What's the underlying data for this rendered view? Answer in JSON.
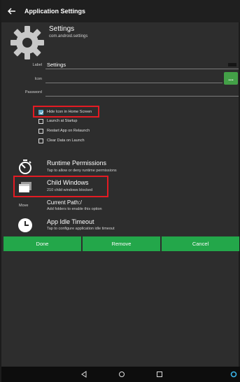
{
  "appbar": {
    "title": "Application Settings"
  },
  "app": {
    "name": "Settings",
    "package": "com.android.settings"
  },
  "form": {
    "label_caption": "Label",
    "label_value": "Settings",
    "icon_caption": "Icon",
    "icon_button": "...",
    "password_caption": "Password"
  },
  "options": [
    {
      "label": "Hide Icon in Home Screen",
      "checked": true
    },
    {
      "label": "Launch at Startup",
      "checked": false
    },
    {
      "label": "Restart App on Relaunch",
      "checked": false
    },
    {
      "label": "Clear Data on Launch",
      "checked": false
    }
  ],
  "sections": {
    "permissions": {
      "title": "Runtime Permissions",
      "subtitle": "Tap to allow or deny runtime permissions"
    },
    "child_windows": {
      "title": "Child Windows",
      "subtitle": "210 child windows blocked"
    },
    "move": {
      "label": "Move",
      "title": "Current Path:/",
      "subtitle": "Add folders to enable this option"
    },
    "idle": {
      "title": "App Idle Timeout",
      "subtitle": "Tap to configure application idle timeout"
    }
  },
  "buttons": {
    "done": "Done",
    "remove": "Remove",
    "cancel": "Cancel"
  },
  "colors": {
    "accent_green": "#23a74a",
    "highlight_red": "#e31b23",
    "checkbox_blue": "#5fa8c8"
  },
  "icons": [
    "back-arrow-icon",
    "gear-icon",
    "stopwatch-icon",
    "windows-icon",
    "clock-icon",
    "nav-back-icon",
    "nav-home-icon",
    "nav-recents-icon",
    "assistant-icon"
  ]
}
